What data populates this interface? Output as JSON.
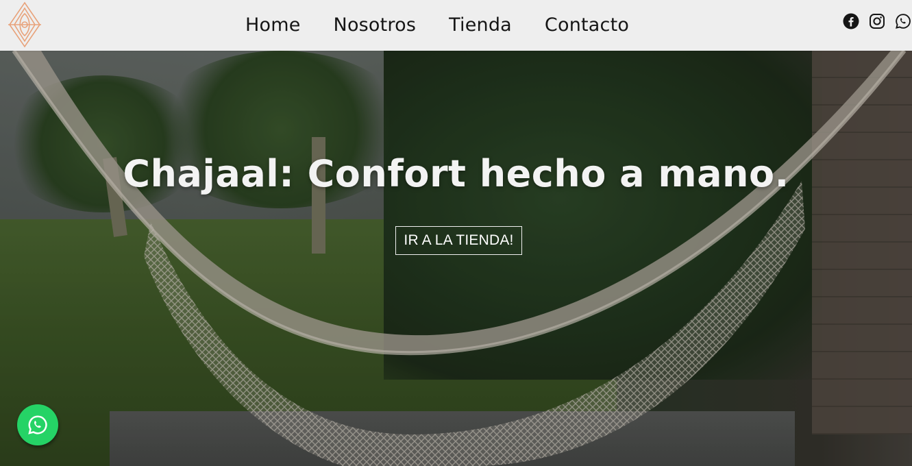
{
  "brand": {
    "logo_icon": "chajaal-diamond-logo-icon",
    "logo_color": "#e8a27a"
  },
  "nav": {
    "items": [
      {
        "label": "Home"
      },
      {
        "label": "Nosotros"
      },
      {
        "label": "Tienda"
      },
      {
        "label": "Contacto"
      }
    ]
  },
  "socials": [
    {
      "icon": "facebook-icon"
    },
    {
      "icon": "instagram-icon"
    },
    {
      "icon": "whatsapp-icon"
    }
  ],
  "hero": {
    "title": "Chajaal: Confort hecho a mano.",
    "cta_label": "IR A LA TIENDA!",
    "background": "hammock-garden-photo"
  },
  "floating_whatsapp": {
    "icon": "whatsapp-icon",
    "color": "#25d366"
  },
  "colors": {
    "header_bg": "#eeeeee",
    "nav_text": "#151515",
    "hero_text": "#f3f3f3"
  }
}
